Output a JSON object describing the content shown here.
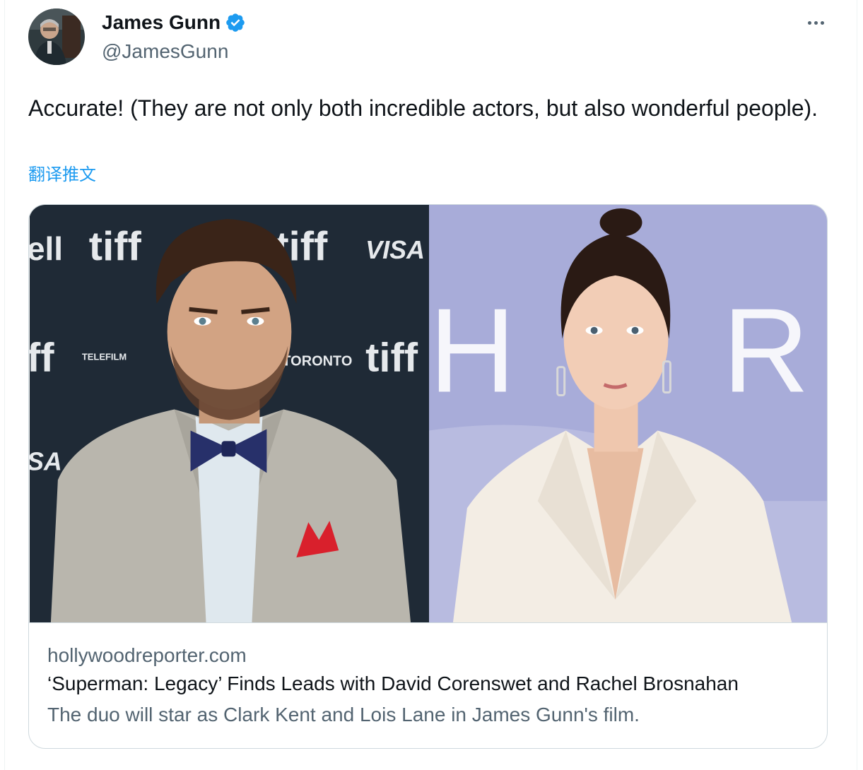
{
  "author": {
    "name": "James Gunn",
    "handle": "@JamesGunn",
    "verified": true
  },
  "tweet": {
    "text": "Accurate! (They are not only both incredible actors, but also wonderful people).",
    "translate_label": "翻译推文"
  },
  "card": {
    "domain": "hollywoodreporter.com",
    "title": "‘Superman: Legacy’ Finds Leads with David Corenswet and Rachel Brosnahan",
    "description": "The duo will star as Clark Kent and Lois Lane in James Gunn's film.",
    "backdrop_left": [
      "ell",
      "tiff",
      "tiff",
      "VISA",
      "ff",
      "TELEFILM",
      "TORONTO",
      "tiff",
      "SA"
    ],
    "backdrop_right": [
      "H",
      "R"
    ]
  },
  "colors": {
    "accent": "#1d9bf0",
    "secondary_text": "#536471",
    "primary_text": "#0f1419",
    "border": "#cfd9de"
  },
  "icons": {
    "verified": "verified-badge-icon",
    "more": "more-horizontal-icon"
  }
}
